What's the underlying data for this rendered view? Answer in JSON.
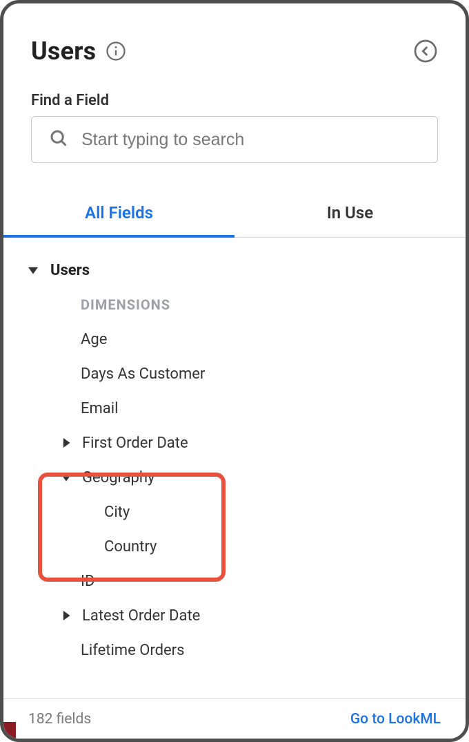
{
  "header": {
    "title": "Users"
  },
  "search": {
    "label": "Find a Field",
    "placeholder": "Start typing to search"
  },
  "tabs": {
    "all_fields": "All Fields",
    "in_use": "In Use"
  },
  "tree": {
    "group": "Users",
    "dimensions_label": "DIMENSIONS",
    "fields": {
      "age": "Age",
      "days_as_customer": "Days As Customer",
      "email": "Email",
      "first_order_date": "First Order Date",
      "geography": "Geography",
      "city": "City",
      "country": "Country",
      "id": "ID",
      "latest_order_date": "Latest Order Date",
      "lifetime_orders": "Lifetime Orders"
    }
  },
  "footer": {
    "count": "182 fields",
    "link": "Go to LookML"
  }
}
